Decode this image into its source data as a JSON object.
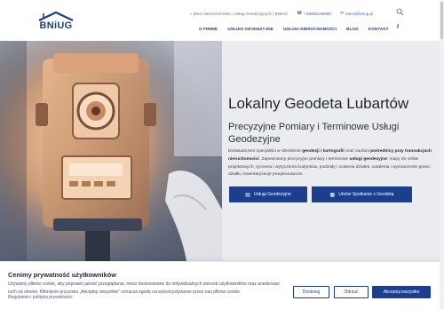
{
  "brand": {
    "logo_text": "BNiUG",
    "color": "#1c3f8c"
  },
  "topbar": {
    "tagline": "« Biuro Nieruchomości i Usług Geodezyjnych | BNiUG",
    "phone": "+48695196986",
    "email": "biuro@bniug.pl",
    "icons": [
      "phone-icon",
      "envelope-icon",
      "search-icon"
    ]
  },
  "nav": {
    "items": [
      "O FIRMIE",
      "USŁUGI GEODEZYJNE",
      "USŁUGI NIERUCHOMOŚCI",
      "BLOG",
      "KONTAKT"
    ],
    "social": "f"
  },
  "hero": {
    "title": "Lokalny Geodeta Lubartów",
    "subtitle": "Precyzyjne Pomiary i Terminowe Usługi Geodezyjne",
    "desc_1": "Doświadczeni specjaliści w dziedzinie ",
    "desc_b1": "geodezji i kartografii",
    "desc_2": " oraz zaufani ",
    "desc_b2": "pośrednicy przy transakcjach nieruchomości",
    "desc_3": ". Zapewniamy precyzyjne pomiary i terminowe ",
    "desc_b3": "usługi geodezyjne",
    "desc_4": ": mapy do celów projektowych, tyczenia i wytyczenia budynków, podziały i scalenia działek, ustalenia i wyznaczenie granic działki, inwentaryzacje powykonawcze.",
    "btn_services": "Usługi Geodezyjne",
    "btn_appointment": "Umów Spotkanie z Geodetą",
    "accent": "#1b3f8e"
  },
  "cookie": {
    "title": "Cenimy prywatność użytkowników",
    "text": "Używamy plików cookie, aby poprawić jakość przeglądania, treści dostosowane do indywidualnych potrzeb użytkowników oraz analizować ruch na stronie. Kliknięcie przycisku „Akceptuj wszystkie” oznacza zgodę na wykorzystywanie przez nas plików cookie.",
    "link": "Regulamin i polityka prywatności",
    "btn_customize": "Dostosuj",
    "btn_reject": "Odrzuć",
    "btn_accept": "Akceptuj wszystko"
  }
}
